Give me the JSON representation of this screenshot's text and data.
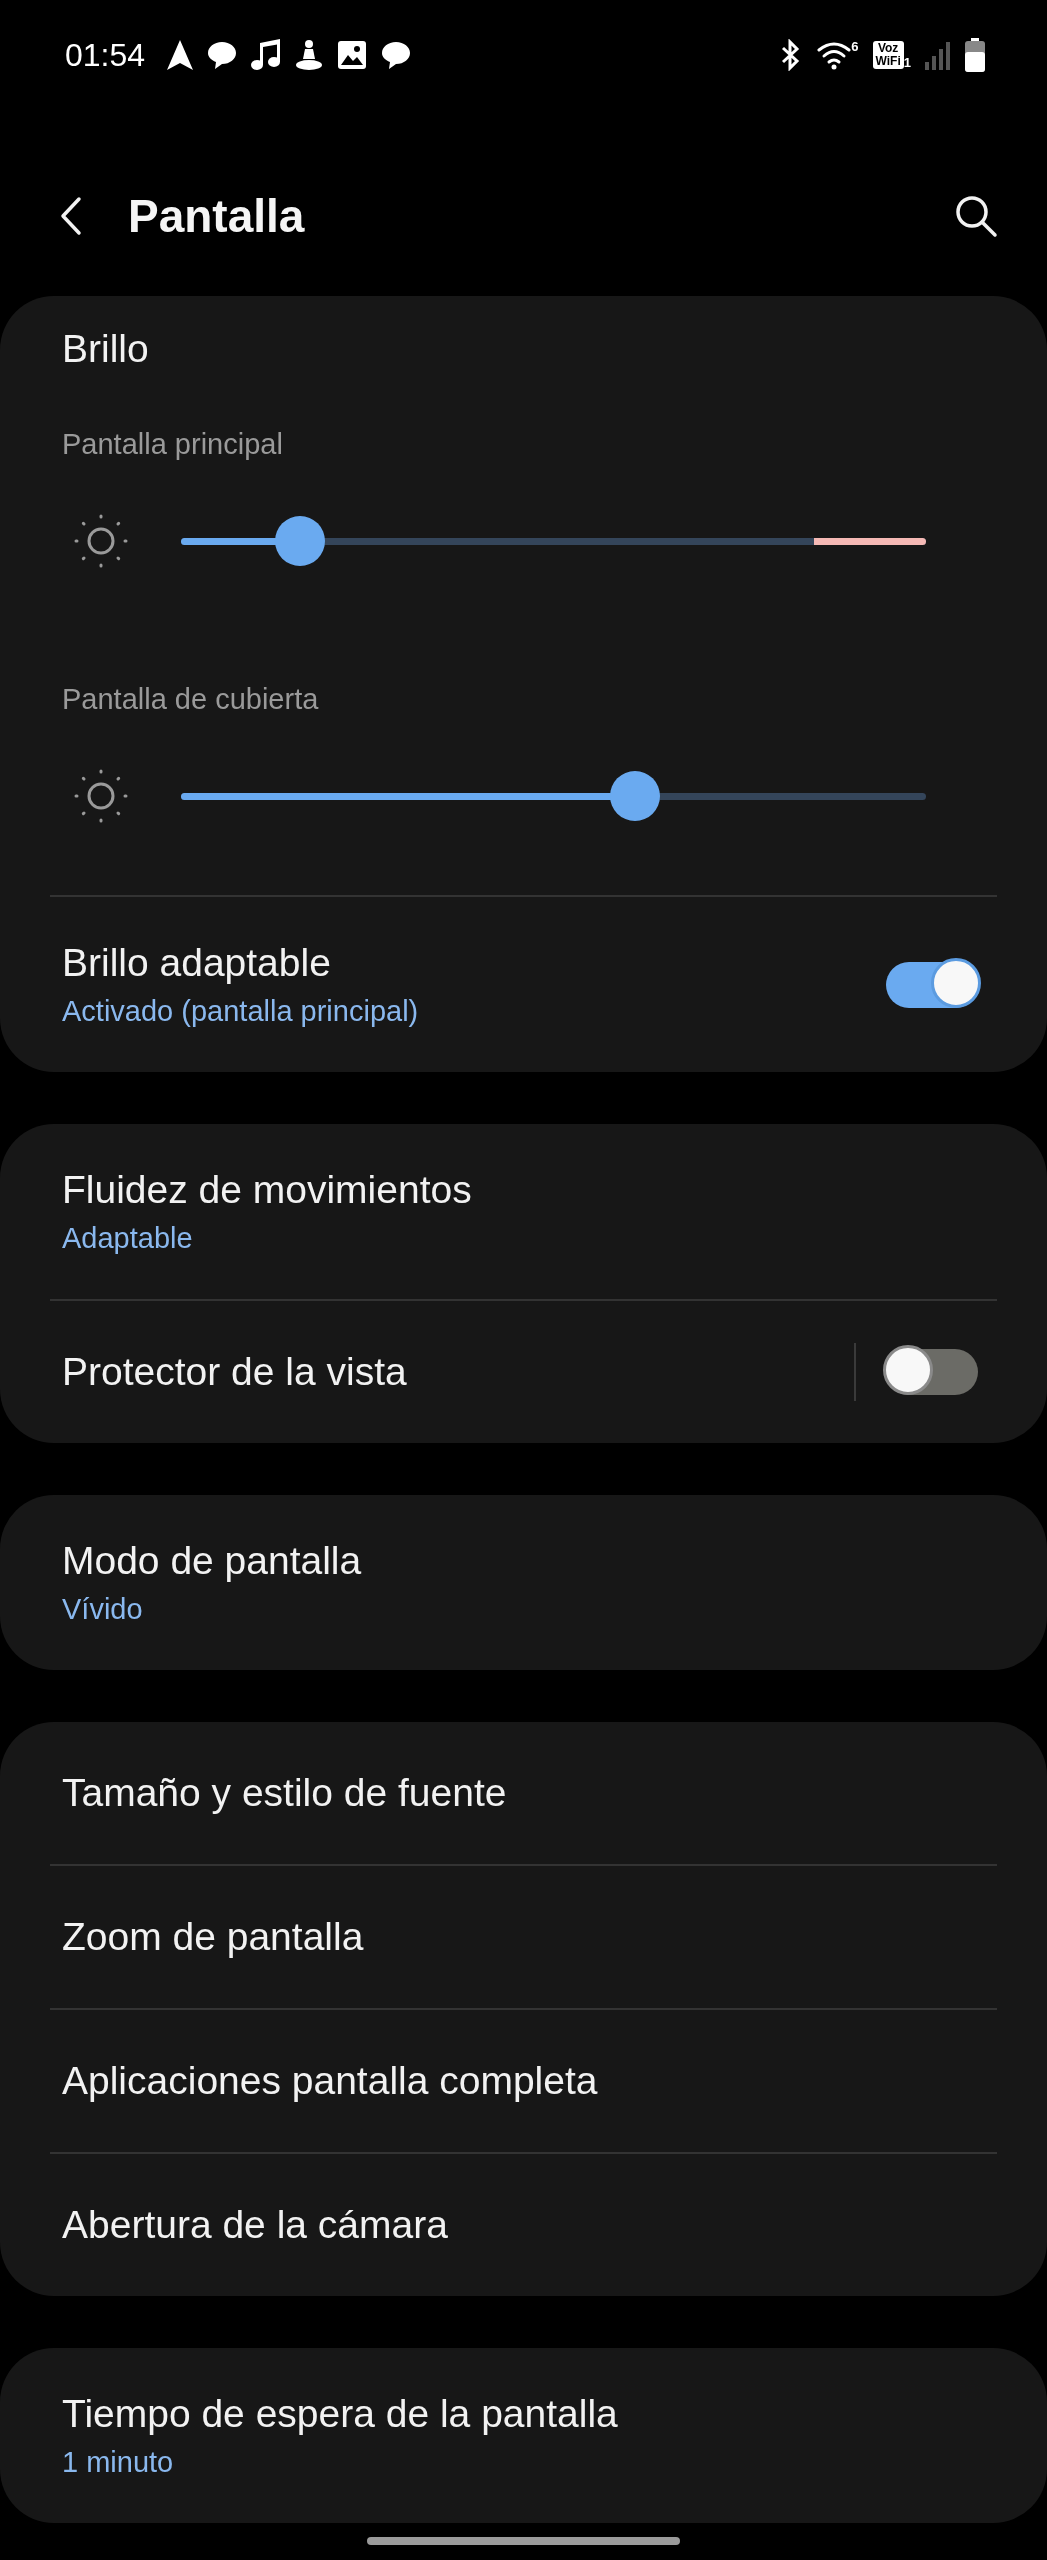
{
  "status_bar": {
    "time": "01:54",
    "wifi_band": "6",
    "wifi_calling": {
      "line_1": "Voz",
      "line_2": "WiFi",
      "sim": "1"
    }
  },
  "header": {
    "title": "Pantalla"
  },
  "groups": [
    {
      "items": [
        {
          "kind": "heading",
          "title": "Brillo"
        },
        {
          "kind": "slider",
          "label": "Pantalla principal",
          "level": 0.16,
          "extra_bright_zone": true
        },
        {
          "kind": "slider",
          "label": "Pantalla de cubierta",
          "level": 0.61,
          "extra_bright_zone": false
        },
        {
          "kind": "toggle",
          "title": "Brillo adaptable",
          "subtitle": "Activado (pantalla principal)",
          "on": true,
          "split": false
        }
      ]
    },
    {
      "items": [
        {
          "kind": "link",
          "title": "Fluidez de movimientos",
          "subtitle": "Adaptable"
        },
        {
          "kind": "toggle",
          "title": "Protector de la vista",
          "on": false,
          "split": true
        }
      ]
    },
    {
      "items": [
        {
          "kind": "link",
          "title": "Modo de pantalla",
          "subtitle": "Vívido"
        }
      ]
    },
    {
      "items": [
        {
          "kind": "link",
          "title": "Tamaño y estilo de fuente"
        },
        {
          "kind": "link",
          "title": "Zoom de pantalla"
        },
        {
          "kind": "link",
          "title": "Aplicaciones pantalla completa"
        },
        {
          "kind": "link",
          "title": "Abertura de la cámara"
        }
      ]
    },
    {
      "items": [
        {
          "kind": "link",
          "title": "Tiempo de espera de la pantalla",
          "subtitle": "1 minuto"
        }
      ]
    }
  ]
}
